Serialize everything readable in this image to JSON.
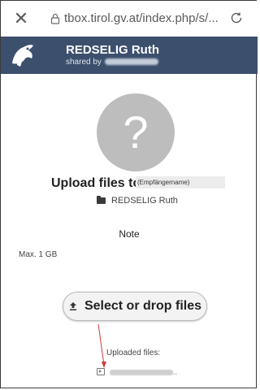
{
  "browser": {
    "url": "tbox.tirol.gv.at/index.php/s/...",
    "close_icon": "close-icon",
    "lock_icon": "lock-icon",
    "reload_icon": "reload-icon"
  },
  "header": {
    "title": "REDSELIG Ruth",
    "shared_by_prefix": "shared by",
    "background_color": "#3c4f6d"
  },
  "main": {
    "avatar_glyph": "?",
    "upload_title": "Upload files to",
    "recipient_placeholder": "(Empfängername)",
    "folder_name": "REDSELIG Ruth",
    "note_label": "Note",
    "max_size": "Max. 1 GB",
    "select_button": "Select or drop files",
    "uploaded_label": "Uploaded files:"
  },
  "colors": {
    "annotation_arrow": "#d23a3a",
    "avatar_bg": "#bdbdbd"
  }
}
